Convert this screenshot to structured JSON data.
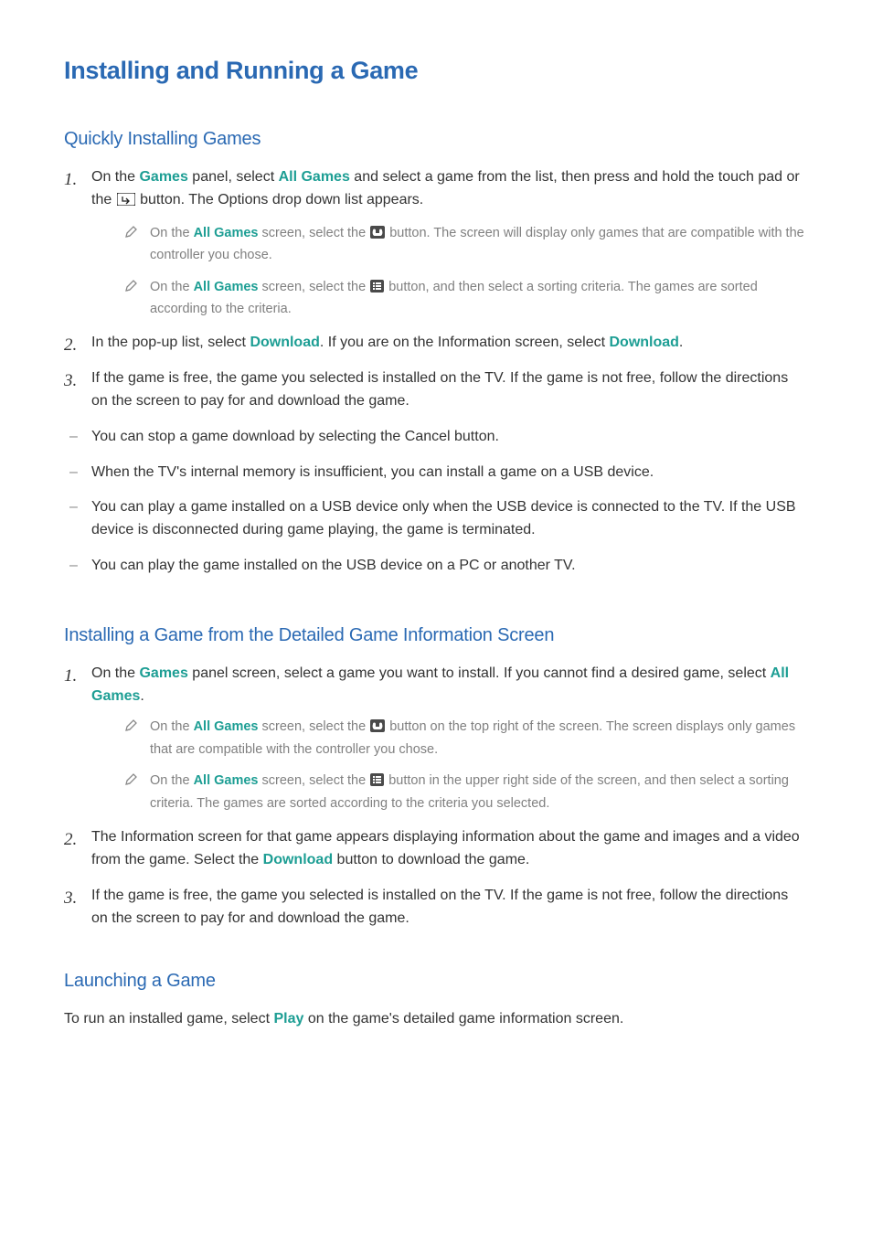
{
  "title": "Installing and Running a Game",
  "s1": {
    "heading": "Quickly Installing Games",
    "step1_a": "On the ",
    "step1_b": " panel, select ",
    "step1_c": " and select a game from the list, then press and hold the touch pad or the ",
    "step1_d": " button. The Options drop down list appears.",
    "kw_games": "Games",
    "kw_allgames": "All Games",
    "note1_a": "On the ",
    "note1_b": " screen, select the ",
    "note1_c": " button. The screen will display only games that are compatible with the controller you chose.",
    "note2_a": "On the ",
    "note2_b": " screen, select the ",
    "note2_c": " button, and then select a sorting criteria. The games are sorted according to the criteria.",
    "step2_a": "In the pop-up list, select ",
    "step2_b": ". If you are on the Information screen, select ",
    "step2_c": ".",
    "kw_download": "Download",
    "step3": "If the game is free, the game you selected is installed on the TV. If the game is not free, follow the directions on the screen to pay for and download the game.",
    "b1": "You can stop a game download by selecting the Cancel button.",
    "b2": "When the TV's internal memory is insufficient, you can install a game on a USB device.",
    "b3": "You can play a game installed on a USB device only when the USB device is connected to the TV. If the USB device is disconnected during game playing, the game is terminated.",
    "b4": "You can play the game installed on the USB device on a PC or another TV."
  },
  "s2": {
    "heading": "Installing a Game from the Detailed Game Information Screen",
    "step1_a": "On the ",
    "step1_b": " panel screen, select a game you want to install. If you cannot find a desired game, select ",
    "step1_c": ".",
    "kw_games": "Games",
    "kw_allgames": "All Games",
    "note1_a": "On the ",
    "note1_b": " screen, select the ",
    "note1_c": " button on the top right of the screen. The screen displays only games that are compatible with the controller you chose.",
    "note2_a": "On the ",
    "note2_b": " screen, select the ",
    "note2_c": " button in the upper right side of the screen, and then select a sorting criteria. The games are sorted according to the criteria you selected.",
    "step2_a": "The Information screen for that game appears displaying information about the game and images and a video from the game. Select the ",
    "step2_b": " button to download the game.",
    "kw_download": "Download",
    "step3": "If the game is free, the game you selected is installed on the TV. If the game is not free, follow the directions on the screen to pay for and download the game."
  },
  "s3": {
    "heading": "Launching a Game",
    "p_a": "To run an installed game, select ",
    "p_b": " on the game's detailed game information screen.",
    "kw_play": "Play"
  }
}
